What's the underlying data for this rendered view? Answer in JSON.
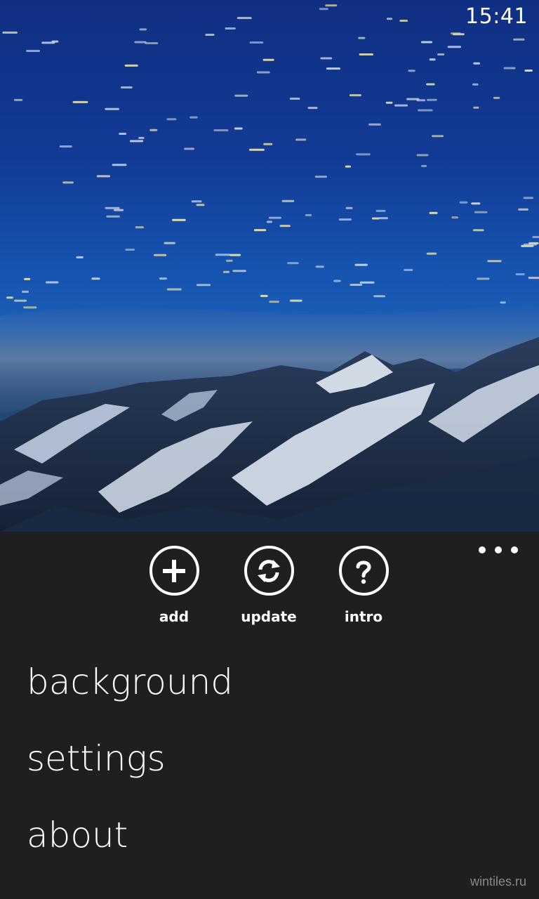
{
  "status_bar": {
    "time": "15:41"
  },
  "app_bar": {
    "buttons": [
      {
        "label": "add",
        "icon": "plus-icon"
      },
      {
        "label": "update",
        "icon": "refresh-icon"
      },
      {
        "label": "intro",
        "icon": "question-icon"
      }
    ],
    "more_icon": "ellipsis-icon",
    "menu_items": [
      "background",
      "settings",
      "about"
    ]
  },
  "watermark": "wintiles.ru",
  "colors": {
    "appbar_bg": "#1f1f1f",
    "sky": "#1655b2",
    "text": "#ffffff"
  }
}
